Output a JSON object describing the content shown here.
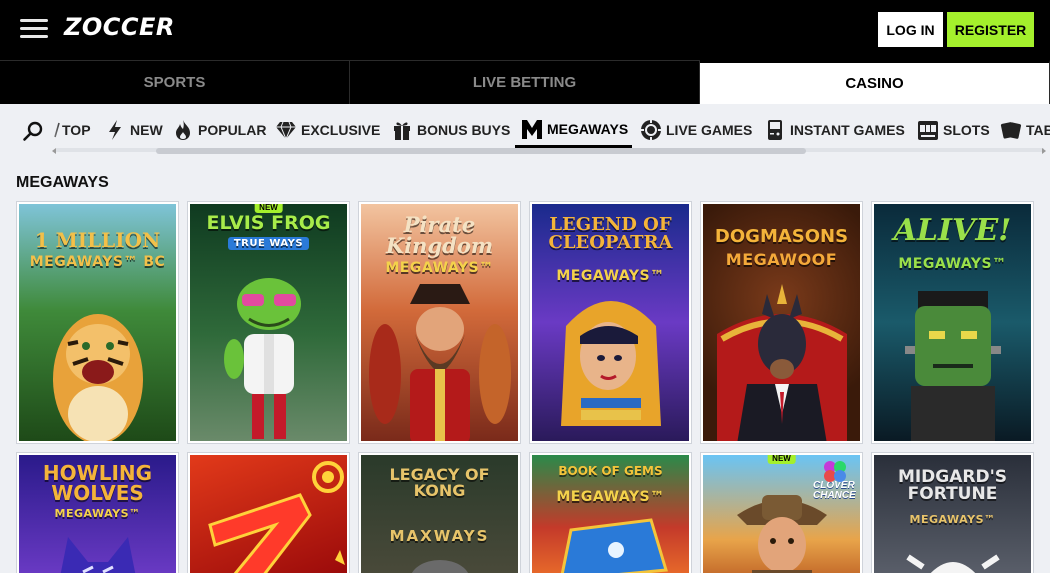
{
  "header": {
    "logo": "ZOCCER",
    "login_label": "LOG IN",
    "register_label": "REGISTER",
    "register_color": "#a4f02c"
  },
  "main_tabs": [
    {
      "label": "SPORTS",
      "active": false
    },
    {
      "label": "LIVE BETTING",
      "active": false
    },
    {
      "label": "CASINO",
      "active": true
    }
  ],
  "categories": [
    {
      "label": "TOP",
      "icon": "top-icon"
    },
    {
      "label": "NEW",
      "icon": "lightning-icon"
    },
    {
      "label": "POPULAR",
      "icon": "flame-icon"
    },
    {
      "label": "EXCLUSIVE",
      "icon": "diamond-icon"
    },
    {
      "label": "BONUS BUYS",
      "icon": "gift-icon"
    },
    {
      "label": "MEGAWAYS",
      "icon": "megaways-icon",
      "active": true
    },
    {
      "label": "LIVE GAMES",
      "icon": "chip-icon"
    },
    {
      "label": "INSTANT GAMES",
      "icon": "gameboy-icon"
    },
    {
      "label": "SLOTS",
      "icon": "slot-machine-icon"
    },
    {
      "label": "TAB",
      "icon": "cards-icon"
    }
  ],
  "section_title": "MEGAWAYS",
  "games": [
    {
      "title": "1 MILLION",
      "subtitle": "MEGAWAYS™ BC",
      "new": false,
      "bg": "#2c5a1e",
      "accent": "#e7b34a"
    },
    {
      "title": "ELVIS FROG",
      "subtitle": "TRUE WAYS",
      "new": true,
      "new_label": "NEW",
      "bg": "#1f4d2a",
      "accent": "#9be04a"
    },
    {
      "title": "Pirate Kingdom",
      "subtitle": "MEGAWAYS™",
      "new": false,
      "bg": "#c15a2e",
      "accent": "#f4d24b"
    },
    {
      "title": "LEGEND OF CLEOPATRA",
      "subtitle": "MEGAWAYS™",
      "new": false,
      "bg": "#3b2a8c",
      "accent": "#f4b43a"
    },
    {
      "title": "DOGMASONS",
      "subtitle": "MEGAWOOF",
      "new": false,
      "bg": "#3a1f14",
      "accent": "#f4a93a"
    },
    {
      "title": "ALIVE!",
      "subtitle": "MEGAWAYS™",
      "new": false,
      "bg": "#0f3a4a",
      "accent": "#8ae04a"
    },
    {
      "title": "HOWLING WOLVES",
      "subtitle": "MEGAWAYS™",
      "new": false,
      "bg": "#2a1a6a",
      "accent": "#f4b43a"
    },
    {
      "title": "",
      "subtitle": "",
      "new": false,
      "bg": "#b31a1a",
      "accent": "#ffd23a"
    },
    {
      "title": "LEGACY OF KONG",
      "subtitle": "MAXWAYS",
      "new": false,
      "bg": "#2a3a2a",
      "accent": "#e7c46a"
    },
    {
      "title": "BOOK OF GEMS",
      "subtitle": "MEGAWAYS™",
      "new": false,
      "bg": "#1a6a3a",
      "accent": "#f4c43a"
    },
    {
      "title": "CLOVER CHANCE",
      "subtitle": "",
      "new": true,
      "new_label": "NEW",
      "bg": "#4aa0d8",
      "accent": "#e7a43a"
    },
    {
      "title": "MIDGARD'S FORTUNE",
      "subtitle": "MEGAWAYS™",
      "new": false,
      "bg": "#3a3f4a",
      "accent": "#e8e8e8"
    }
  ]
}
